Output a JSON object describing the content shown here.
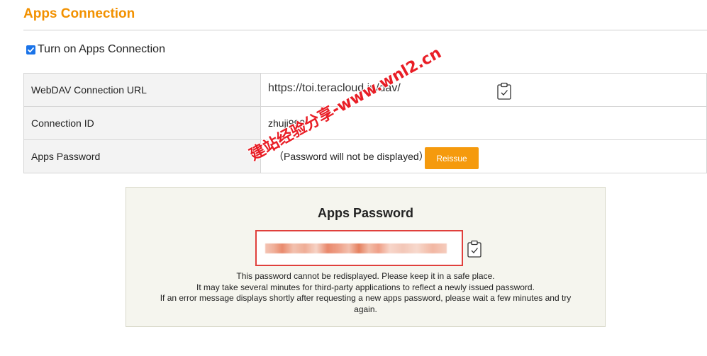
{
  "header": {
    "title": "Apps Connection"
  },
  "toggle": {
    "label": "Turn on Apps Connection",
    "checked": true
  },
  "settings": {
    "rows": [
      {
        "label": "WebDAV Connection URL",
        "value": "https://toi.teracloud.jp/dav/",
        "icon": "clipboard-check-icon"
      },
      {
        "label": "Connection ID",
        "value": "zhuji999"
      },
      {
        "label": "Apps Password",
        "value": "（Password will not be displayed）",
        "button": "Reissue"
      }
    ]
  },
  "watermark": {
    "text": "建站经验分享-www.wnl2.cn"
  },
  "password_panel": {
    "title": "Apps Password",
    "notes": [
      "This password cannot be redisplayed. Please keep it in a safe place.",
      "It may take several minutes for third-party applications to reflect a newly issued password.",
      "If an error message displays shortly after requesting a new apps password, please wait a few minutes and try",
      "again."
    ]
  },
  "colors": {
    "accent": "#f29100",
    "button": "#f59a0d",
    "highlight_border": "#e0403c",
    "panel_bg": "#f5f5ee",
    "watermark": "#e8121b"
  }
}
